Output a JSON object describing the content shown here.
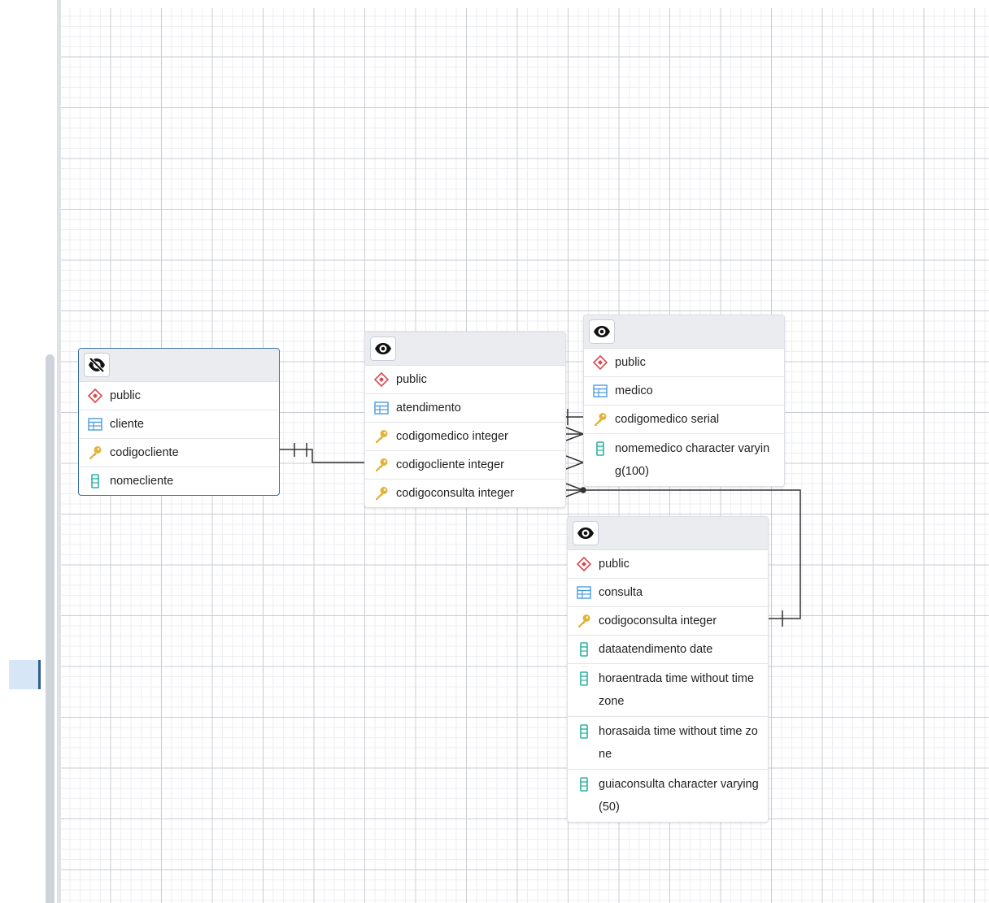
{
  "nodes": {
    "cliente": {
      "schema": "public",
      "table": "cliente",
      "columns": [
        {
          "label": "codigocliente",
          "kind": "key-icon"
        },
        {
          "label": "nomecliente",
          "kind": "column-icon"
        }
      ]
    },
    "atendimento": {
      "schema": "public",
      "table": "atendimento",
      "columns": [
        {
          "label": "codigomedico integer",
          "kind": "key-icon"
        },
        {
          "label": "codigocliente integer",
          "kind": "key-icon"
        },
        {
          "label": "codigoconsulta integer",
          "kind": "key-icon"
        }
      ]
    },
    "medico": {
      "schema": "public",
      "table": "medico",
      "columns": [
        {
          "label": "codigomedico serial",
          "kind": "key-icon"
        },
        {
          "label": "nomemedico character varying(100)",
          "kind": "column-icon"
        }
      ]
    },
    "consulta": {
      "schema": "public",
      "table": "consulta",
      "columns": [
        {
          "label": "codigoconsulta integer",
          "kind": "key-icon"
        },
        {
          "label": "dataatendimento date",
          "kind": "column-icon"
        },
        {
          "label": "horaentrada time without time zone",
          "kind": "column-icon"
        },
        {
          "label": "horasaida time without time zone",
          "kind": "column-icon"
        },
        {
          "label": "guiaconsulta character varying(50)",
          "kind": "column-icon"
        }
      ]
    }
  },
  "colors": {
    "grid_major": "#c9ccd4",
    "grid_minor": "#eceef2",
    "selected_border": "#3b6fa7",
    "key_icon": "#e0b33a",
    "column_icon": "#2bb3a0",
    "schema_icon": "#d9484f",
    "table_icon": "#4a9be0",
    "relation_line": "#333333"
  }
}
